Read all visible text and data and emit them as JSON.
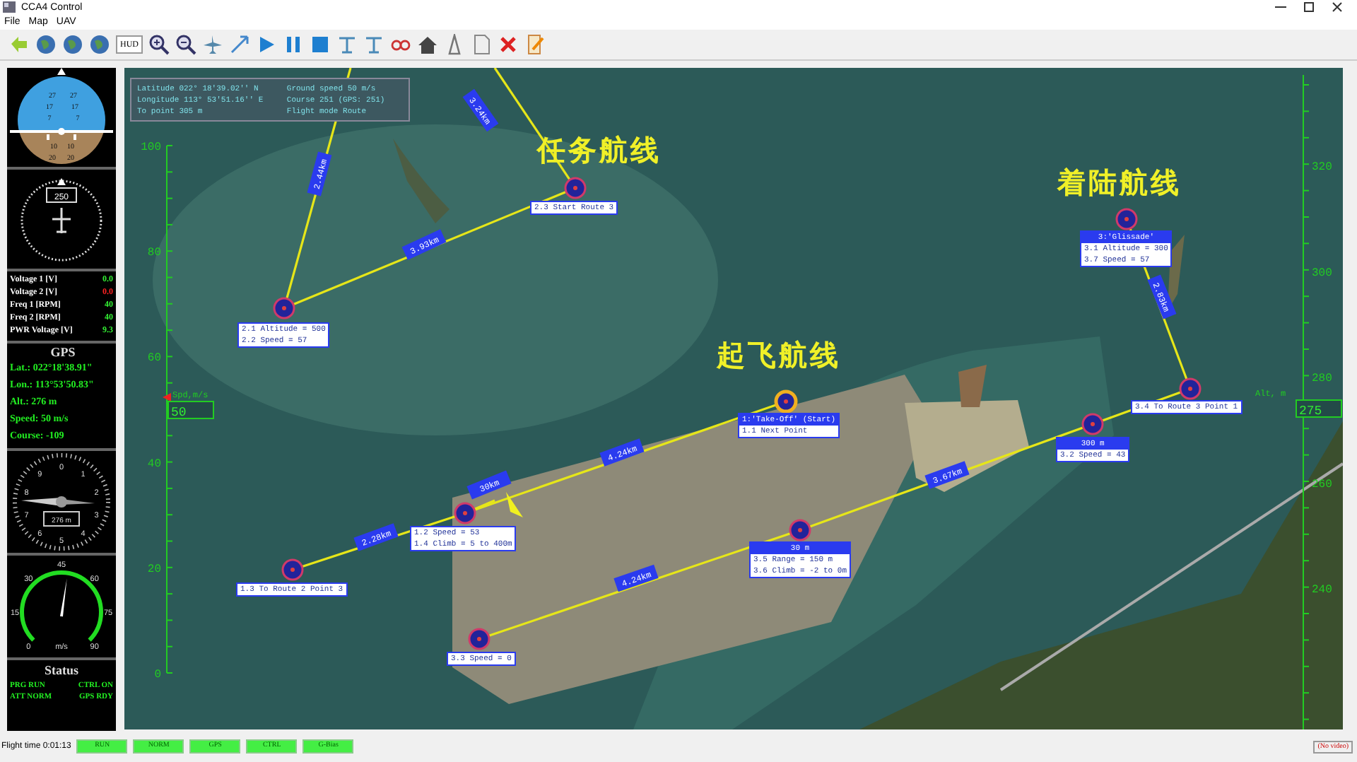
{
  "window": {
    "title": "CCA4 Control"
  },
  "menu": [
    "File",
    "Map",
    "UAV"
  ],
  "toolbar": {
    "hud_label": "HUD"
  },
  "instruments": {
    "attitude": {
      "pitch_labels": [
        "27",
        "27",
        "17",
        "17",
        "7",
        "7",
        "10",
        "10",
        "20",
        "20"
      ]
    },
    "compass": {
      "heading": "250"
    },
    "readings": [
      {
        "label": "Voltage 1 [V]",
        "value": "0.0",
        "alarm": false
      },
      {
        "label": "Voltage 2 [V]",
        "value": "0.0",
        "alarm": true
      },
      {
        "label": "Freq 1 [RPM]",
        "value": "40",
        "alarm": false
      },
      {
        "label": "Freq 2 [RPM]",
        "value": "40",
        "alarm": false
      },
      {
        "label": "PWR Voltage [V]",
        "value": "9.3",
        "alarm": false
      }
    ],
    "gps": {
      "title": "GPS",
      "lines": [
        "Lat.: 022°18'38.91\"",
        "Lon.: 113°53'50.83\"",
        "Alt.: 276 m",
        "Speed: 50 m/s",
        "Course: -109"
      ]
    },
    "altimeter": {
      "digits": [
        "0",
        "1",
        "2",
        "3",
        "4",
        "5",
        "6",
        "7",
        "8",
        "9"
      ],
      "reading": "276 m"
    },
    "speedometer": {
      "ticks": [
        "0",
        "15",
        "30",
        "45",
        "60",
        "75",
        "90"
      ],
      "unit": "m/s",
      "level": 0.53
    },
    "status": {
      "title": "Status",
      "items": [
        "PRG RUN",
        "CTRL ON",
        "ATT NORM",
        "GPS RDY"
      ]
    }
  },
  "map": {
    "info": [
      "Latitude 022° 18'39.02'' N",
      "Ground speed 50 m/s",
      "Longitude 113° 53'51.16'' E",
      "Course 251 (GPS: 251)",
      "To point 305 m",
      "Flight mode Route"
    ],
    "route_titles": [
      "任务航线",
      "着陆航线",
      "起飞航线"
    ],
    "waypoints": [
      {
        "lines": [
          "2.3 Start Route 3"
        ],
        "current": false
      },
      {
        "lines": [
          "2.1 Altitude = 500",
          "2.2 Speed = 57"
        ],
        "current": false
      },
      {
        "header": "3:'Glissade'",
        "lines": [
          "3.1 Altitude = 300",
          "3.7 Speed = 57"
        ],
        "current": false
      },
      {
        "lines": [
          "3.4 To Route 3 Point 1"
        ],
        "current": false
      },
      {
        "header": "300 m",
        "lines": [
          "3.2 Speed = 43"
        ],
        "current": false
      },
      {
        "header": "1:'Take-Off' (Start)",
        "lines": [
          "1.1 Next Point"
        ],
        "current": true
      },
      {
        "header": "30 m",
        "lines": [
          "3.5 Range = 150 m",
          "3.6 Climb = -2 to 0m"
        ],
        "current": false
      },
      {
        "lines": [
          "1.2 Speed = 53",
          "1.4 Climb = 5 to 400m"
        ],
        "current": false
      },
      {
        "lines": [
          "1.3 To Route 2 Point 3"
        ],
        "current": false
      },
      {
        "lines": [
          "3.3 Speed = 0"
        ],
        "current": false
      }
    ],
    "segments": [
      {
        "label": "3.24km"
      },
      {
        "label": "2.44km"
      },
      {
        "label": "3.93km"
      },
      {
        "label": "4.24km"
      },
      {
        "label": "2.28km"
      },
      {
        "label": "30km"
      },
      {
        "label": "4.24km"
      },
      {
        "label": "3.67km"
      },
      {
        "label": "2.83km"
      }
    ],
    "speed_scale": {
      "ticks": [
        "100",
        "80",
        "60",
        "40",
        "20",
        "0"
      ],
      "label": "Spd,m/s",
      "value": "50"
    },
    "alt_scale": {
      "ticks": [
        "320",
        "300",
        "280",
        "260",
        "240"
      ],
      "label": "Alt, m",
      "value": "275"
    }
  },
  "status_bar": {
    "flight_time": "Flight time 0:01:13",
    "indicators": [
      "RUN",
      "NORM",
      "GPS",
      "CTRL",
      "G-Bias"
    ],
    "video": "(No video)"
  }
}
